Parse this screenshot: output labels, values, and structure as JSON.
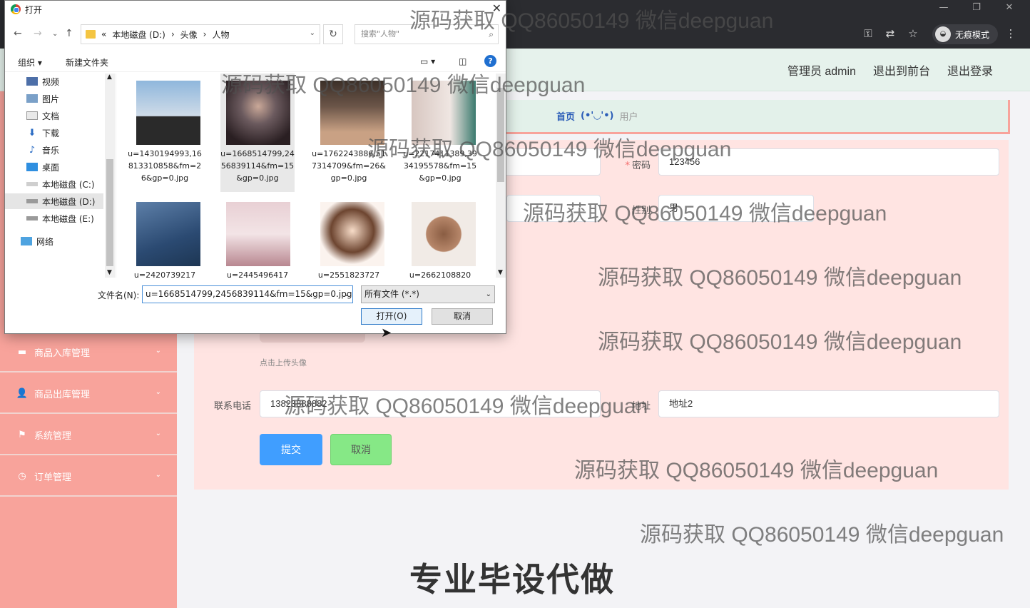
{
  "browser": {
    "incognito_label": "无痕模式",
    "icons": [
      "key-icon",
      "translate-icon",
      "star-icon",
      "menu-icon"
    ]
  },
  "header": {
    "admin_label": "管理员 admin",
    "front_label": "退出到前台",
    "logout_label": "退出登录"
  },
  "breadcrumb": {
    "home": "首页",
    "emoticon": "(•'◡'•)",
    "current": "用户"
  },
  "sidebar": {
    "items": [
      {
        "label": "商品入库管理",
        "icon": "ticket-icon"
      },
      {
        "label": "商品出库管理",
        "icon": "user-icon"
      },
      {
        "label": "系统管理",
        "icon": "flag-icon"
      },
      {
        "label": "订单管理",
        "icon": "clock-icon"
      }
    ]
  },
  "form": {
    "password_label": "密码",
    "password_value": "123456",
    "gender_label": "性别",
    "gender_value": "男",
    "upload_hint": "点击上传头像",
    "phone_label": "联系电话",
    "phone_value": "13823888882",
    "address_label": "地址",
    "address_value": "地址2",
    "submit_label": "提交",
    "cancel_label": "取消"
  },
  "dialog": {
    "title": "打开",
    "path_prefix": "«",
    "path": [
      "本地磁盘 (D:)",
      "头像",
      "人物"
    ],
    "search_placeholder": "搜索\"人物\"",
    "organize_label": "组织 ▾",
    "new_folder_label": "新建文件夹",
    "tree": [
      {
        "label": "视频",
        "icon": "video-icon",
        "selected": false
      },
      {
        "label": "图片",
        "icon": "pictures-icon",
        "selected": false
      },
      {
        "label": "文档",
        "icon": "documents-icon",
        "selected": false
      },
      {
        "label": "下载",
        "icon": "download-icon",
        "selected": false
      },
      {
        "label": "音乐",
        "icon": "music-icon",
        "selected": false
      },
      {
        "label": "桌面",
        "icon": "desktop-icon",
        "selected": false
      },
      {
        "label": "本地磁盘 (C:)",
        "icon": "drive-icon",
        "selected": false
      },
      {
        "label": "本地磁盘 (D:)",
        "icon": "drive-icon",
        "selected": true
      },
      {
        "label": "本地磁盘 (E:)",
        "icon": "drive-icon",
        "selected": false
      },
      {
        "label": "网络",
        "icon": "network-icon",
        "selected": false
      }
    ],
    "files": [
      {
        "name": "u=1430194993,16813310858&fm=26&gp=0.jpg",
        "selected": false,
        "colors": [
          "#8fb7dc",
          "#2a2a2a"
        ]
      },
      {
        "name": "u=1668514799,2456839114&fm=15&gp=0.jpg",
        "selected": true,
        "colors": [
          "#6b5a5e",
          "#2a1f22"
        ]
      },
      {
        "name": "u=1762243886,517314709&fm=26&gp=0.jpg",
        "selected": false,
        "colors": [
          "#6b5548",
          "#c9a184"
        ]
      },
      {
        "name": "u=2217411389,3934195578&fm=15&gp=0.jpg",
        "selected": false,
        "colors": [
          "#d7c6c0",
          "#3c7a6e"
        ]
      },
      {
        "name": "u=2420739217",
        "selected": false,
        "colors": [
          "#5d7fa8",
          "#1d3653"
        ]
      },
      {
        "name": "u=2445496417",
        "selected": false,
        "colors": [
          "#e8d0d4",
          "#b88790"
        ]
      },
      {
        "name": "u=2551823727",
        "selected": false,
        "colors": [
          "#fbf3ee",
          "#6d4530"
        ]
      },
      {
        "name": "u=2662108820",
        "selected": false,
        "colors": [
          "#f1ebe6",
          "#8a5d43"
        ]
      }
    ],
    "filename_label": "文件名(N):",
    "filename_value": "u=1668514799,2456839114&fm=15&gp=0.jpg",
    "filetype_value": "所有文件 (*.*)",
    "open_label": "打开(O)",
    "cancel_label": "取消"
  },
  "watermarks": [
    "源码获取 QQ86050149 微信deepguan",
    "源码获取 QQ86050149 微信deepguan",
    "源码获取 QQ86050149 微信deepguan",
    "源码获取 QQ86050149 微信deepguan",
    "源码获取 QQ86050149 微信deepguan",
    "源码获取 QQ86050149 微信deepguan",
    "源码获取 QQ86050149 微信deepguan",
    "源码获取 QQ86050149 微信deepguan",
    "源码获取 QQ86050149 微信deepguan"
  ],
  "banner": "专业毕设代做"
}
